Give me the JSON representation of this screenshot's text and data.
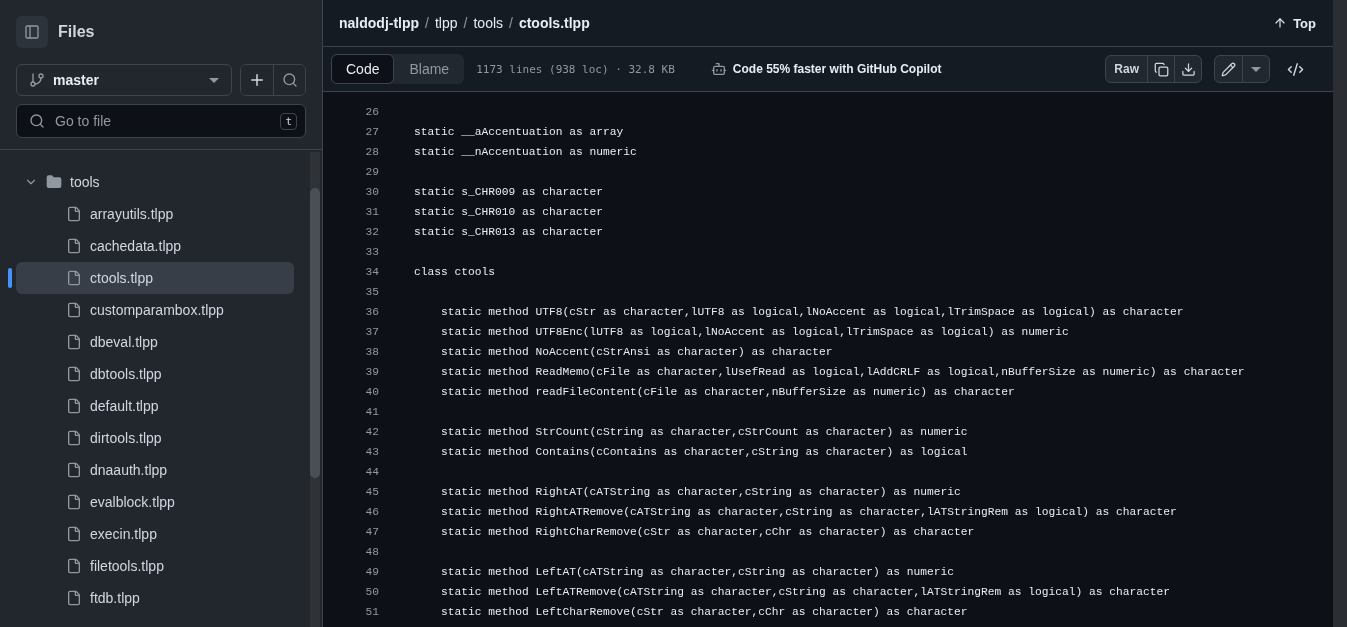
{
  "sidebar": {
    "title": "Files",
    "branch": "master",
    "search": {
      "placeholder": "Go to file",
      "shortcut": "t"
    },
    "tree": [
      {
        "kind": "folder",
        "name": "tools",
        "expanded": true,
        "children": [
          {
            "kind": "file",
            "name": "arrayutils.tlpp",
            "selected": false
          },
          {
            "kind": "file",
            "name": "cachedata.tlpp",
            "selected": false
          },
          {
            "kind": "file",
            "name": "ctools.tlpp",
            "selected": true
          },
          {
            "kind": "file",
            "name": "customparambox.tlpp",
            "selected": false
          },
          {
            "kind": "file",
            "name": "dbeval.tlpp",
            "selected": false
          },
          {
            "kind": "file",
            "name": "dbtools.tlpp",
            "selected": false
          },
          {
            "kind": "file",
            "name": "default.tlpp",
            "selected": false
          },
          {
            "kind": "file",
            "name": "dirtools.tlpp",
            "selected": false
          },
          {
            "kind": "file",
            "name": "dnaauth.tlpp",
            "selected": false
          },
          {
            "kind": "file",
            "name": "evalblock.tlpp",
            "selected": false
          },
          {
            "kind": "file",
            "name": "execin.tlpp",
            "selected": false
          },
          {
            "kind": "file",
            "name": "filetools.tlpp",
            "selected": false
          },
          {
            "kind": "file",
            "name": "ftdb.tlpp",
            "selected": false
          }
        ]
      }
    ]
  },
  "breadcrumb": [
    {
      "text": "naldodj-tlpp",
      "kind": "repo"
    },
    {
      "text": "/",
      "kind": "separator"
    },
    {
      "text": "tlpp",
      "kind": "dir"
    },
    {
      "text": "/",
      "kind": "separator"
    },
    {
      "text": "tools",
      "kind": "dir"
    },
    {
      "text": "/",
      "kind": "separator"
    },
    {
      "text": "ctools.tlpp",
      "kind": "file"
    }
  ],
  "top_link": "Top",
  "tabs": [
    {
      "label": "Code",
      "selected": true
    },
    {
      "label": "Blame",
      "selected": false
    }
  ],
  "file_info": "1173 lines (938 loc) · 32.8 KB",
  "copilot": "Code 55% faster with GitHub Copilot",
  "raw_button": "Raw",
  "code": [
    {
      "number": "26"
    },
    {
      "number": "27",
      "text": "static __aAccentuation as array"
    },
    {
      "number": "28",
      "text": "static __nAccentuation as numeric"
    },
    {
      "number": "29"
    },
    {
      "number": "30",
      "text": "static s_CHR009 as character"
    },
    {
      "number": "31",
      "text": "static s_CHR010 as character"
    },
    {
      "number": "32",
      "text": "static s_CHR013 as character"
    },
    {
      "number": "33"
    },
    {
      "number": "34",
      "text": "class ctools"
    },
    {
      "number": "35"
    },
    {
      "number": "36",
      "text": "    static method UTF8(cStr as character,lUTF8 as logical,lNoAccent as logical,lTrimSpace as logical) as character"
    },
    {
      "number": "37",
      "text": "    static method UTF8Enc(lUTF8 as logical,lNoAccent as logical,lTrimSpace as logical) as numeric"
    },
    {
      "number": "38",
      "text": "    static method NoAccent(cStrAnsi as character) as character"
    },
    {
      "number": "39",
      "text": "    static method ReadMemo(cFile as character,lUsefRead as logical,lAddCRLF as logical,nBufferSize as numeric) as character"
    },
    {
      "number": "40",
      "text": "    static method readFileContent(cFile as character,nBufferSize as numeric) as character"
    },
    {
      "number": "41"
    },
    {
      "number": "42",
      "text": "    static method StrCount(cString as character,cStrCount as character) as numeric"
    },
    {
      "number": "43",
      "text": "    static method Contains(cContains as character,cString as character) as logical"
    },
    {
      "number": "44"
    },
    {
      "number": "45",
      "text": "    static method RightAT(cATString as character,cString as character) as numeric"
    },
    {
      "number": "46",
      "text": "    static method RightATRemove(cATString as character,cString as character,lATStringRem as logical) as character"
    },
    {
      "number": "47",
      "text": "    static method RightCharRemove(cStr as character,cChr as character) as character"
    },
    {
      "number": "48"
    },
    {
      "number": "49",
      "text": "    static method LeftAT(cATString as character,cString as character) as numeric"
    },
    {
      "number": "50",
      "text": "    static method LeftATRemove(cATString as character,cString as character,lATStringRem as logical) as character"
    },
    {
      "number": "51",
      "text": "    static method LeftCharRemove(cStr as character,cChr as character) as character"
    }
  ]
}
